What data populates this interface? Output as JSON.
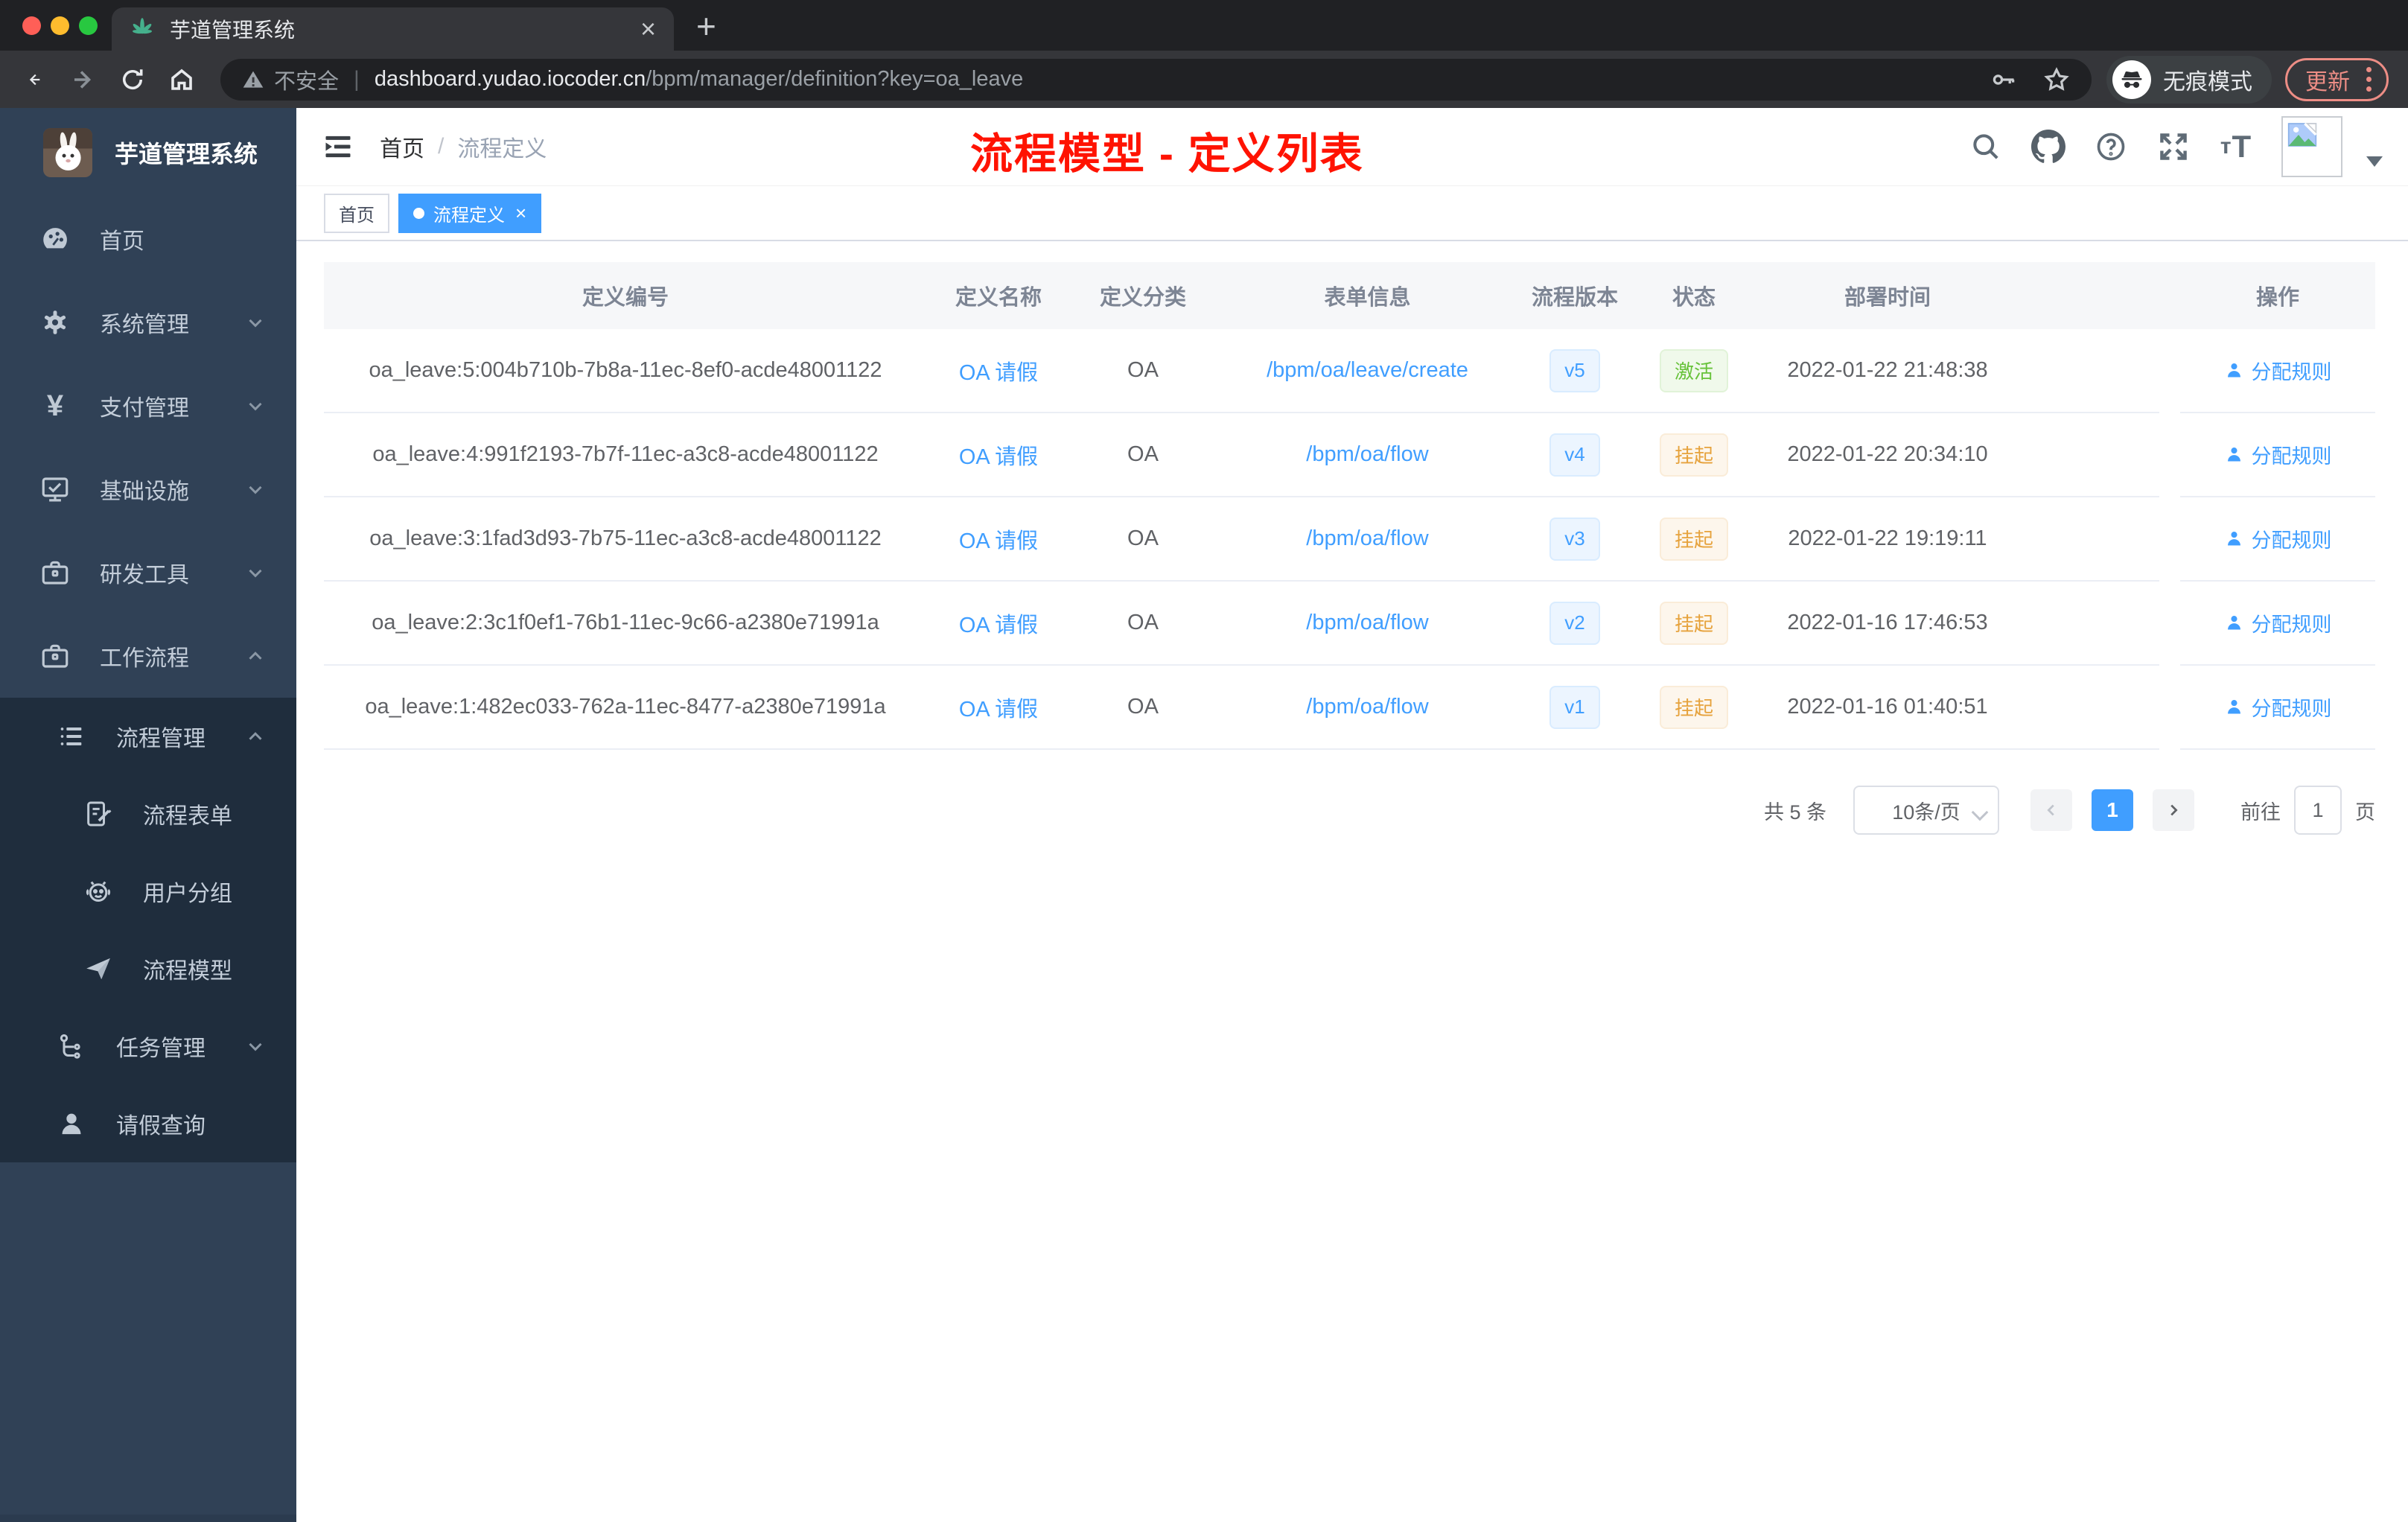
{
  "browser": {
    "tab_title": "芋道管理系统",
    "new_tab_glyph": "+",
    "close_glyph": "×",
    "security_label": "不安全",
    "url_host": "dashboard.yudao.iocoder.cn",
    "url_path": "/bpm/manager/definition?key=oa_leave",
    "incognito_label": "无痕模式",
    "update_label": "更新"
  },
  "sidebar": {
    "logo_title": "芋道管理系统",
    "items": [
      {
        "label": "首页"
      },
      {
        "label": "系统管理"
      },
      {
        "label": "支付管理"
      },
      {
        "label": "基础设施"
      },
      {
        "label": "研发工具"
      },
      {
        "label": "工作流程"
      }
    ],
    "submenu": [
      {
        "label": "流程管理"
      },
      {
        "label": "流程表单"
      },
      {
        "label": "用户分组"
      },
      {
        "label": "流程模型"
      },
      {
        "label": "任务管理"
      },
      {
        "label": "请假查询"
      }
    ]
  },
  "navbar": {
    "breadcrumb_home": "首页",
    "breadcrumb_sep": "/",
    "breadcrumb_current": "流程定义",
    "annotation": "流程模型 - 定义列表"
  },
  "tags": [
    {
      "label": "首页"
    },
    {
      "label": "流程定义",
      "close": "×"
    }
  ],
  "table": {
    "columns": [
      "定义编号",
      "定义名称",
      "定义分类",
      "表单信息",
      "流程版本",
      "状态",
      "部署时间",
      "操作"
    ],
    "rows": [
      {
        "id": "oa_leave:5:004b710b-7b8a-11ec-8ef0-acde48001122",
        "name": "OA 请假",
        "category": "OA",
        "form": "/bpm/oa/leave/create",
        "version": "v5",
        "status": "激活",
        "status_type": "success",
        "deploy_time": "2022-01-22 21:48:38",
        "action": "分配规则"
      },
      {
        "id": "oa_leave:4:991f2193-7b7f-11ec-a3c8-acde48001122",
        "name": "OA 请假",
        "category": "OA",
        "form": "/bpm/oa/flow",
        "version": "v4",
        "status": "挂起",
        "status_type": "warning",
        "deploy_time": "2022-01-22 20:34:10",
        "action": "分配规则"
      },
      {
        "id": "oa_leave:3:1fad3d93-7b75-11ec-a3c8-acde48001122",
        "name": "OA 请假",
        "category": "OA",
        "form": "/bpm/oa/flow",
        "version": "v3",
        "status": "挂起",
        "status_type": "warning",
        "deploy_time": "2022-01-22 19:19:11",
        "action": "分配规则"
      },
      {
        "id": "oa_leave:2:3c1f0ef1-76b1-11ec-9c66-a2380e71991a",
        "name": "OA 请假",
        "category": "OA",
        "form": "/bpm/oa/flow",
        "version": "v2",
        "status": "挂起",
        "status_type": "warning",
        "deploy_time": "2022-01-16 17:46:53",
        "action": "分配规则"
      },
      {
        "id": "oa_leave:1:482ec033-762a-11ec-8477-a2380e71991a",
        "name": "OA 请假",
        "category": "OA",
        "form": "/bpm/oa/flow",
        "version": "v1",
        "status": "挂起",
        "status_type": "warning",
        "deploy_time": "2022-01-16 01:40:51",
        "action": "分配规则"
      }
    ]
  },
  "pagination": {
    "total": "共 5 条",
    "page_size": "10条/页",
    "current_page": "1",
    "goto_label": "前往",
    "goto_value": "1",
    "page_unit": "页"
  },
  "colors": {
    "accent": "#409eff",
    "success": "#67c23a",
    "warning": "#e6a23c",
    "annotation_red": "#ff1302",
    "sidebar_bg": "#304156",
    "submenu_bg": "#1f2d3d",
    "chrome_bg": "#202124",
    "chrome_toolbar": "#35363a",
    "update_red": "#ed8d85"
  }
}
